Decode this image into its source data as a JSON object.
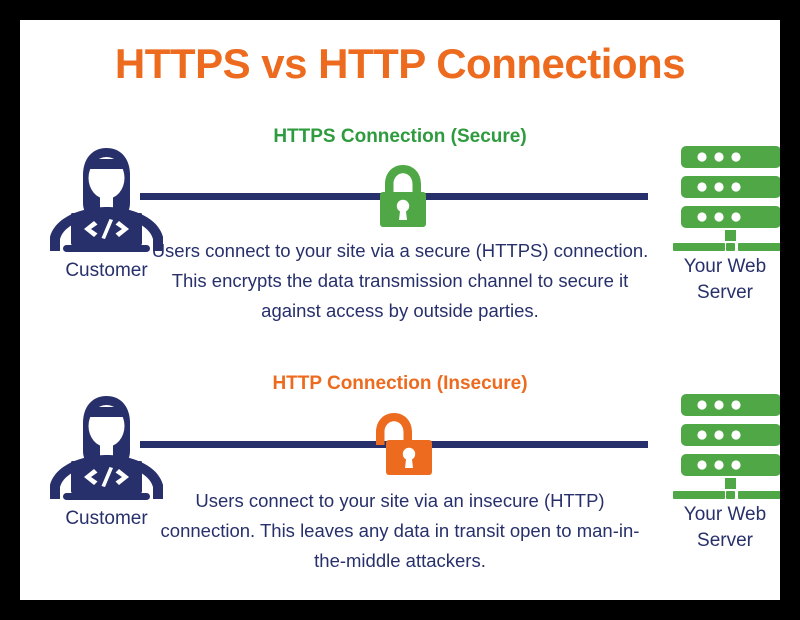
{
  "page": {
    "title": "HTTPS vs HTTP Connections",
    "border_color": "#000000",
    "background_color": "#ffffff"
  },
  "colors": {
    "orange": "#ED6B1F",
    "green": "#4FA845",
    "green_text": "#2E9B3F",
    "navy": "#27306B"
  },
  "sections": [
    {
      "id": "https",
      "subtitle": "HTTPS Connection (Secure)",
      "subtitle_color": "#2E9B3F",
      "lock_icon": "lock-closed-icon",
      "lock_color": "#4FA845",
      "customer_label": "Customer",
      "customer_icon": "customer-person-laptop-icon",
      "server_label": "Your Web Server",
      "server_icon": "web-server-icon",
      "body": "Users connect to your site via a secure (HTTPS) connection. This encrypts the data transmission channel to secure it against access by outside parties."
    },
    {
      "id": "http",
      "subtitle": "HTTP Connection (Insecure)",
      "subtitle_color": "#ED6B1F",
      "lock_icon": "lock-open-icon",
      "lock_color": "#ED6B1F",
      "customer_label": "Customer",
      "customer_icon": "customer-person-laptop-icon",
      "server_label": "Your Web Server",
      "server_icon": "web-server-icon",
      "body": "Users connect to your site via an insecure (HTTP) connection. This leaves any data in transit open to man-in-the-middle attackers."
    }
  ]
}
